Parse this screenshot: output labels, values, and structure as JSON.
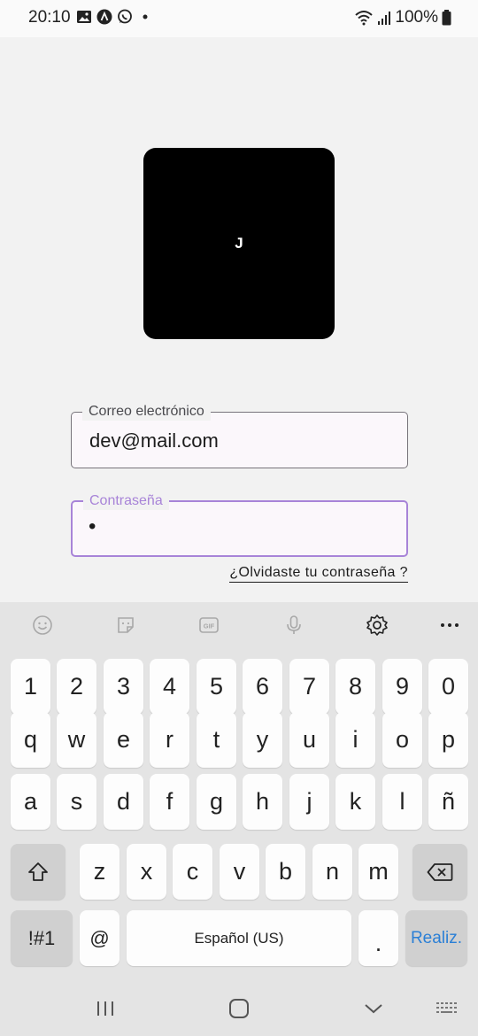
{
  "status_bar": {
    "time": "20:10",
    "battery": "100%",
    "icons": [
      "image-icon",
      "a-app-icon",
      "whatsapp-icon",
      "dot-icon",
      "wifi-icon",
      "signal-icon",
      "battery-icon"
    ]
  },
  "logo": {
    "text": "J",
    "background": "#000000"
  },
  "login": {
    "email_label": "Correo electrónico",
    "email_value": "dev@mail.com",
    "password_label": "Contraseña",
    "password_value": "•",
    "forgot_link": "¿Olvidaste tu contraseña ?",
    "accent_color": "#a884d8"
  },
  "keyboard": {
    "toolbar": [
      "emoji-icon",
      "sticker-icon",
      "gif-icon",
      "mic-icon",
      "settings-icon",
      "more-icon"
    ],
    "row_numbers": [
      "1",
      "2",
      "3",
      "4",
      "5",
      "6",
      "7",
      "8",
      "9",
      "0"
    ],
    "row_1": [
      "q",
      "w",
      "e",
      "r",
      "t",
      "y",
      "u",
      "i",
      "o",
      "p"
    ],
    "row_2": [
      "a",
      "s",
      "d",
      "f",
      "g",
      "h",
      "j",
      "k",
      "l",
      "ñ"
    ],
    "row_3": [
      "z",
      "x",
      "c",
      "v",
      "b",
      "n",
      "m"
    ],
    "sym_key": "!#1",
    "at_key": "@",
    "space_key": "Español (US)",
    "period_key": ".",
    "enter_key": "Realiz.",
    "enter_color": "#2a7fd6"
  },
  "navbar": [
    "recents-icon",
    "home-icon",
    "back-icon",
    "keyboard-switch-icon"
  ]
}
